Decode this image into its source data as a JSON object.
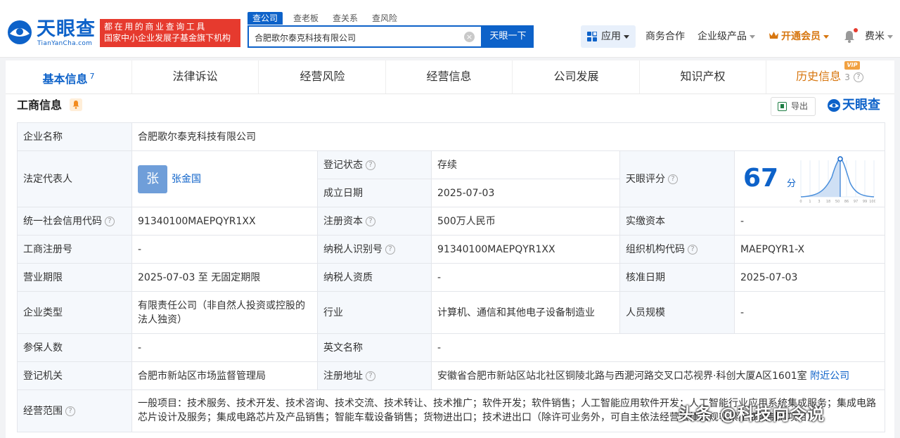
{
  "header": {
    "logo_cn": "天眼查",
    "logo_en": "TianYanCha.com",
    "promo_line1": "都在用的商业查询工具",
    "promo_line2": "国家中小企业发展子基金旗下机构",
    "search_tabs": [
      "查公司",
      "查老板",
      "查关系",
      "查风险"
    ],
    "search_value": "合肥歌尔泰克科技有限公司",
    "search_button": "天眼一下",
    "apps_label": "应用",
    "nav": [
      "商务合作",
      "企业级产品"
    ],
    "vip_label": "开通会员",
    "user_name": "费米"
  },
  "tabs": [
    {
      "label": "基本信息",
      "count": "7"
    },
    {
      "label": "法律诉讼"
    },
    {
      "label": "经营风险"
    },
    {
      "label": "经营信息"
    },
    {
      "label": "公司发展"
    },
    {
      "label": "知识产权"
    },
    {
      "label": "历史信息",
      "count": "3",
      "badge": "VIP"
    }
  ],
  "section": {
    "title": "工商信息",
    "export_label": "导出",
    "brand_label": "天眼查"
  },
  "info": {
    "company_name_label": "企业名称",
    "company_name": "合肥歌尔泰克科技有限公司",
    "legal_rep_label": "法定代表人",
    "legal_rep_avatar": "张",
    "legal_rep": "张金国",
    "reg_status_label": "登记状态",
    "reg_status": "存续",
    "found_date_label": "成立日期",
    "found_date": "2025-07-03",
    "score_label": "天眼评分",
    "score": "67",
    "score_unit": "分",
    "score_axis": [
      "0",
      "1",
      "3",
      "18",
      "50",
      "86",
      "97",
      "99",
      "100"
    ],
    "credit_code_label": "统一社会信用代码",
    "credit_code": "91340100MAEPQYR1XX",
    "reg_capital_label": "注册资本",
    "reg_capital": "500万人民币",
    "paid_capital_label": "实缴资本",
    "paid_capital": "-",
    "biz_reg_no_label": "工商注册号",
    "biz_reg_no": "-",
    "taxpayer_id_label": "纳税人识别号",
    "taxpayer_id": "91340100MAEPQYR1XX",
    "org_code_label": "组织机构代码",
    "org_code": "MAEPQYR1-X",
    "term_label": "营业期限",
    "term": "2025-07-03 至 无固定期限",
    "taxpayer_qual_label": "纳税人资质",
    "taxpayer_qual": "-",
    "approve_date_label": "核准日期",
    "approve_date": "2025-07-03",
    "type_label": "企业类型",
    "type": "有限责任公司（非自然人投资或控股的法人独资）",
    "industry_label": "行业",
    "industry": "计算机、通信和其他电子设备制造业",
    "staff_label": "人员规模",
    "staff": "-",
    "insured_label": "参保人数",
    "insured": "-",
    "en_name_label": "英文名称",
    "en_name": "-",
    "authority_label": "登记机关",
    "authority": "合肥市新站区市场监督管理局",
    "address_label": "注册地址",
    "address": "安徽省合肥市新站区站北社区铜陵北路与西淝河路交叉口芯视界·科创大厦A区1601室",
    "nearby_link": "附近公司",
    "scope_label": "经营范围",
    "scope": "一般项目：技术服务、技术开发、技术咨询、技术交流、技术转让、技术推广；软件开发；软件销售；人工智能应用软件开发；人工智能行业应用系统集成服务；集成电路芯片设计及服务；集成电路芯片及产品销售；智能车载设备销售；货物进出口；技术进出口（除许可业务外，可自主依法经营法律法规非禁止或限制的项目）"
  },
  "watermark": "头条 @科技向令说"
}
